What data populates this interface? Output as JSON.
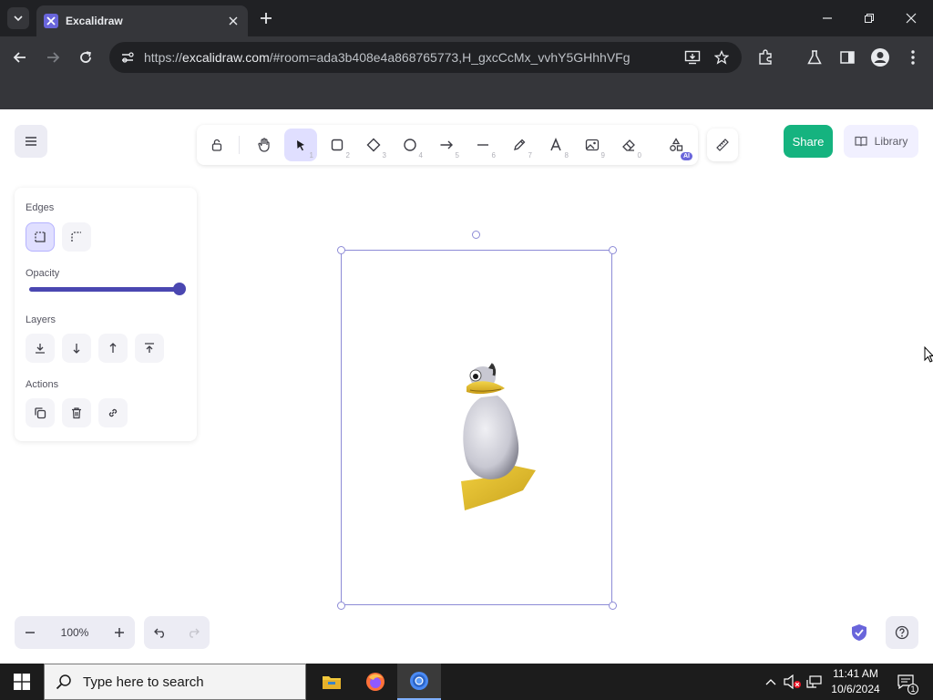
{
  "browser": {
    "tab_title": "Excalidraw",
    "url_prefix": "https://",
    "url_host": "excalidraw.com",
    "url_rest": "/#room=ada3b408e4a868765773,H_gxcCcMx_vvhY5GHhhVFg"
  },
  "toolbar": {
    "tools": [
      {
        "name": "lock",
        "num": ""
      },
      {
        "name": "hand",
        "num": ""
      },
      {
        "name": "selection",
        "num": "1"
      },
      {
        "name": "rectangle",
        "num": "2"
      },
      {
        "name": "diamond",
        "num": "3"
      },
      {
        "name": "ellipse",
        "num": "4"
      },
      {
        "name": "arrow",
        "num": "5"
      },
      {
        "name": "line",
        "num": "6"
      },
      {
        "name": "draw",
        "num": "7"
      },
      {
        "name": "text",
        "num": "8"
      },
      {
        "name": "image",
        "num": "9"
      },
      {
        "name": "eraser",
        "num": "0"
      },
      {
        "name": "ai",
        "num": ""
      }
    ],
    "ai_badge": "AI",
    "share_label": "Share",
    "library_label": "Library"
  },
  "properties": {
    "edges_label": "Edges",
    "opacity_label": "Opacity",
    "opacity_value": 100,
    "layers_label": "Layers",
    "actions_label": "Actions"
  },
  "footer": {
    "zoom": "100%"
  },
  "taskbar": {
    "search_placeholder": "Type here to search",
    "time": "11:41 AM",
    "date": "10/6/2024",
    "notification_count": "1"
  },
  "colors": {
    "accent": "#6965db",
    "share": "#15b37f",
    "selection": "#8d8bd6"
  }
}
